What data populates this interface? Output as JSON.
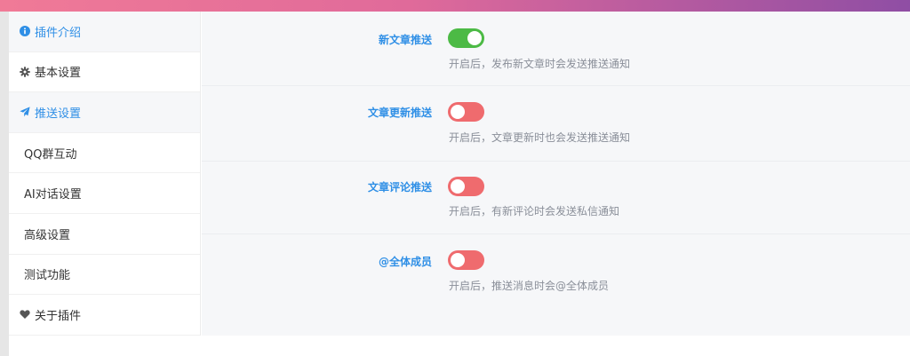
{
  "colors": {
    "accent": "#2f8fe6",
    "toggle_on": "#4cba45",
    "toggle_off": "#ef6b6e",
    "desc_text": "#8a8f99"
  },
  "sidebar": {
    "items": [
      {
        "label": "插件介绍",
        "icon": "info-circle-icon"
      },
      {
        "label": "基本设置",
        "icon": "gear-icon"
      },
      {
        "label": "推送设置",
        "icon": "paper-plane-icon"
      },
      {
        "label": "QQ群互动"
      },
      {
        "label": "AI对话设置"
      },
      {
        "label": "高级设置"
      },
      {
        "label": "测试功能"
      },
      {
        "label": "关于插件",
        "icon": "heart-icon"
      }
    ]
  },
  "settings": [
    {
      "label": "新文章推送",
      "enabled": true,
      "desc": "开启后，发布新文章时会发送推送通知"
    },
    {
      "label": "文章更新推送",
      "enabled": false,
      "desc": "开启后，文章更新时也会发送推送通知"
    },
    {
      "label": "文章评论推送",
      "enabled": false,
      "desc": "开启后，有新评论时会发送私信通知"
    },
    {
      "label": "@全体成员",
      "enabled": false,
      "desc": "开启后，推送消息时会@全体成员"
    }
  ]
}
